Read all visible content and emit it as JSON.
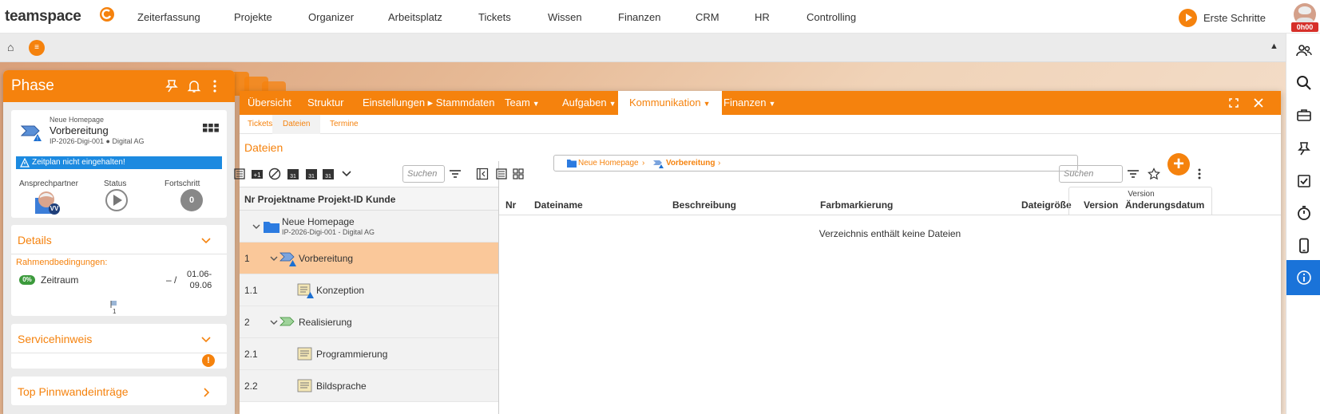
{
  "app": {
    "logo_text": "teamspace",
    "nav": [
      "Zeiterfassung",
      "Projekte",
      "Organizer",
      "Arbeitsplatz",
      "Tickets",
      "Wissen",
      "Finanzen",
      "CRM",
      "HR",
      "Controlling"
    ],
    "erste_schritte": "Erste Schritte",
    "timer": "0h00",
    "menu_glyph": "≡"
  },
  "phase_panel": {
    "title": "Phase",
    "project_parent": "Neue Homepage",
    "project_name": "Vorbereitung",
    "project_id": "IP-2026-Digi-001 ● Digital AG",
    "warning": "Zeitplan nicht eingehalten!",
    "col_ansprechpartner": "Ansprechpartner",
    "col_status": "Status",
    "col_fortschritt": "Fortschritt",
    "avatar_initials": "VV",
    "fortschritt_value": "0",
    "details": {
      "title": "Details",
      "rahmen": "Rahmendbedingungen:",
      "zeitraum_pct": "0%",
      "zeitraum_label": "Zeitraum",
      "zeitraum_dash": "– /",
      "zeitraum_date_1": "01.06-",
      "zeitraum_date_2": "09.06",
      "flag_count": "1"
    },
    "service_title": "Servicehinweis",
    "service_badge": "!",
    "pinn_title": "Top Pinnwandeinträge"
  },
  "window": {
    "tabs": [
      {
        "label": "Übersicht",
        "dropdown": false
      },
      {
        "label": "Struktur",
        "dropdown": false
      },
      {
        "label": "Einstellungen ▸ Stammdaten",
        "dropdown": false
      },
      {
        "label": "Team",
        "dropdown": true
      },
      {
        "label": "Aufgaben",
        "dropdown": true
      },
      {
        "label": "Kommunikation",
        "dropdown": true
      },
      {
        "label": "Finanzen",
        "dropdown": true
      }
    ],
    "dropdown_glyph": "▼",
    "subtabs": [
      "Tickets",
      "Dateien",
      "Termine"
    ],
    "section_title": "Dateien",
    "tree_search_placeholder": "Suchen",
    "tree_header": "Nr  Projektname Projekt-ID Kunde",
    "tree_root": {
      "name": "Neue Homepage",
      "sub": "IP-2026-Digi-001 - Digital AG"
    },
    "tree_rows": [
      {
        "nr": "1",
        "label": "Vorbereitung"
      },
      {
        "nr": "1.1",
        "label": "Konzeption"
      },
      {
        "nr": "2",
        "label": "Realisierung"
      },
      {
        "nr": "2.1",
        "label": "Programmierung"
      },
      {
        "nr": "2.2",
        "label": "Bildsprache"
      }
    ],
    "breadcrumb": [
      "Neue Homepage",
      "Vorbereitung"
    ],
    "breadcrumb_sep": "›",
    "file_search_placeholder": "Suchen",
    "add_glyph": "+",
    "file_columns": {
      "nr": "Nr",
      "name": "Dateiname",
      "desc": "Beschreibung",
      "color": "Farbmarkierung",
      "size": "Dateigröße",
      "version_group": "Version",
      "version": "Version",
      "changed": "Änderungsdatum"
    },
    "empty_message": "Verzeichnis enthält keine Dateien"
  },
  "colors": {
    "accent": "#f5820d",
    "info_blue": "#1c8ae0",
    "active_sidebar": "#1a73d9",
    "selected_row": "#fac89a"
  }
}
